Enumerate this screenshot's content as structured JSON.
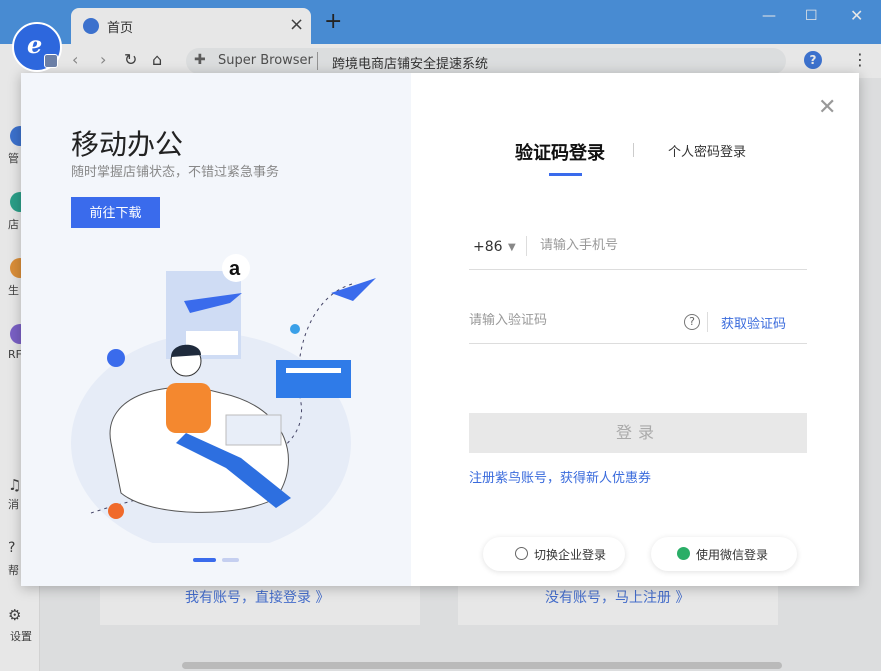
{
  "browser": {
    "tab_title": "首页",
    "brand": "Super Browser",
    "page_title": "跨境电商店铺安全提速系统",
    "help": "?"
  },
  "sidebar": {
    "items": [
      {
        "label": "管",
        "color": "#2f6fe0"
      },
      {
        "label": "店",
        "color": "#1aa88c"
      },
      {
        "label": "生",
        "color": "#f0932b"
      },
      {
        "label": "RF",
        "color": "#7b5bd6"
      }
    ],
    "bottom": [
      {
        "label": "消"
      },
      {
        "label": "帮"
      },
      {
        "label": "设置"
      }
    ]
  },
  "cards": {
    "have_account": "我有账号，直接登录 》",
    "no_account": "没有账号，马上注册 》"
  },
  "modal": {
    "left": {
      "heading": "移动办公",
      "subheading": "随时掌握店铺状态，不错过紧急事务",
      "download_button": "前往下载",
      "amazon_letter": "a"
    },
    "tabs": {
      "sms": "验证码登录",
      "password": "个人密码登录"
    },
    "country_code": "+86",
    "phone_placeholder": "请输入手机号",
    "code_placeholder": "请输入验证码",
    "get_code": "获取验证码",
    "login_button": "登录",
    "register_link": "注册紫鸟账号，获得新人优惠券",
    "enterprise_login": "切换企业登录",
    "wechat_login": "使用微信登录",
    "colors": {
      "accent": "#3a6bec",
      "link": "#3a6bdc",
      "wechat": "#2aae67"
    }
  }
}
